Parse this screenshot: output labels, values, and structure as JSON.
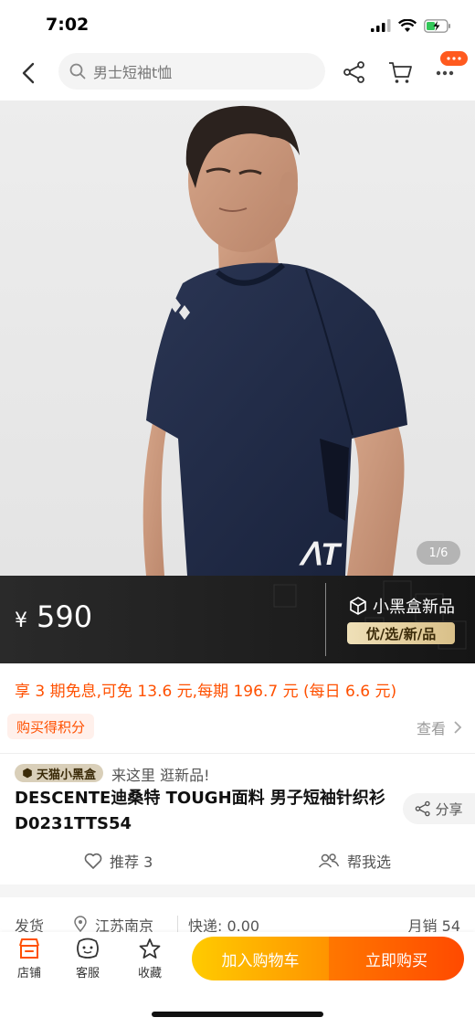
{
  "status_bar": {
    "time": "7:02"
  },
  "nav": {
    "search_text": "男士短袖t恤",
    "icons": [
      "back-icon",
      "search-icon",
      "share-icon",
      "cart-icon",
      "more-icon"
    ]
  },
  "gallery": {
    "counter": "1/6"
  },
  "price_band": {
    "currency": "¥",
    "price": "590",
    "brand_label": "小黑盒新品",
    "slogan": "优/选/新/品"
  },
  "installment_text": "享 3 期免息,可免 13.6 元,每期 196.7 元 (每日 6.6 元)",
  "points": {
    "tag": "购买得积分",
    "view_more": "查看"
  },
  "product": {
    "badge": "天猫小黑盒",
    "promo": "来这里 逛新品!",
    "title": "DESCENTE迪桑特 TOUGH面料 男子短袖针织衫 D0231TTS54",
    "share": "分享"
  },
  "actions": {
    "recommend": "推荐 3",
    "help_choose": "帮我选"
  },
  "shipping": {
    "label": "发货",
    "location": "江苏南京",
    "express": "快递: 0.00",
    "monthly_sales": "月销 54"
  },
  "bottom_bar": {
    "store": "店铺",
    "service": "客服",
    "favorite": "收藏",
    "add_to_cart": "加入购物车",
    "buy_now": "立即购买"
  },
  "colors": {
    "accent_orange": "#ff5000",
    "cart_gradient": [
      "#ffcb00",
      "#ff9400"
    ],
    "buy_gradient": [
      "#ff7700",
      "#ff4a00"
    ],
    "shirt_navy": "#1f2a44"
  }
}
